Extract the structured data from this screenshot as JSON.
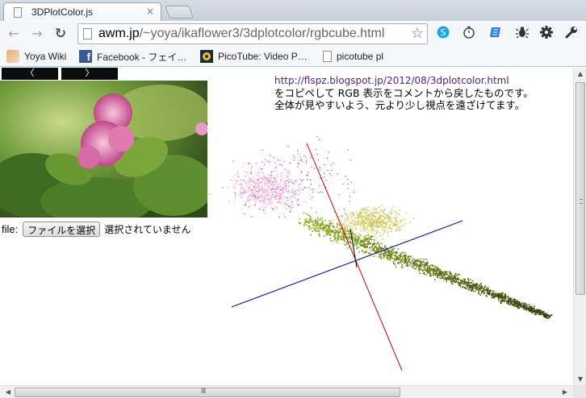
{
  "tab": {
    "title": "3DPlotColor.js",
    "close": "×"
  },
  "toolbar": {
    "back": "←",
    "forward": "→",
    "reload": "↻",
    "url_host": "awm.jp",
    "url_path": "/~yoya/ikaflower3/3dplotcolor/rgbcube.html",
    "star": "☆"
  },
  "bookmarks": [
    {
      "label": "Yoya Wiki",
      "icon": "yoya-wiki-icon"
    },
    {
      "label": "Facebook - フェイ…",
      "icon": "facebook-icon"
    },
    {
      "label": "PicoTube: Video P…",
      "icon": "picotube-icon"
    },
    {
      "label": "picotube pl",
      "icon": "page-icon"
    }
  ],
  "nav": {
    "prev": "〈",
    "next": "〉"
  },
  "file": {
    "label": "file:",
    "button": "ファイルを選択",
    "status": "選択されていません"
  },
  "info": {
    "link": "http://flspz.blogspot.jp/2012/08/3dplotcolor.html",
    "line1": "をコピペして RGB 表示をコメントから戻したものです。",
    "line2": "全体が見やすいよう、元より少し視点を遠ざけてます。"
  },
  "scrollbar": {
    "up": "▲",
    "down": "▼",
    "left": "◀",
    "right": "▶",
    "hgrip": "Ⅲ"
  },
  "colors": {
    "axis_red": "#cc0000",
    "axis_blue": "#0000cc",
    "axis_dark": "#000000",
    "link": "#551a8b"
  }
}
